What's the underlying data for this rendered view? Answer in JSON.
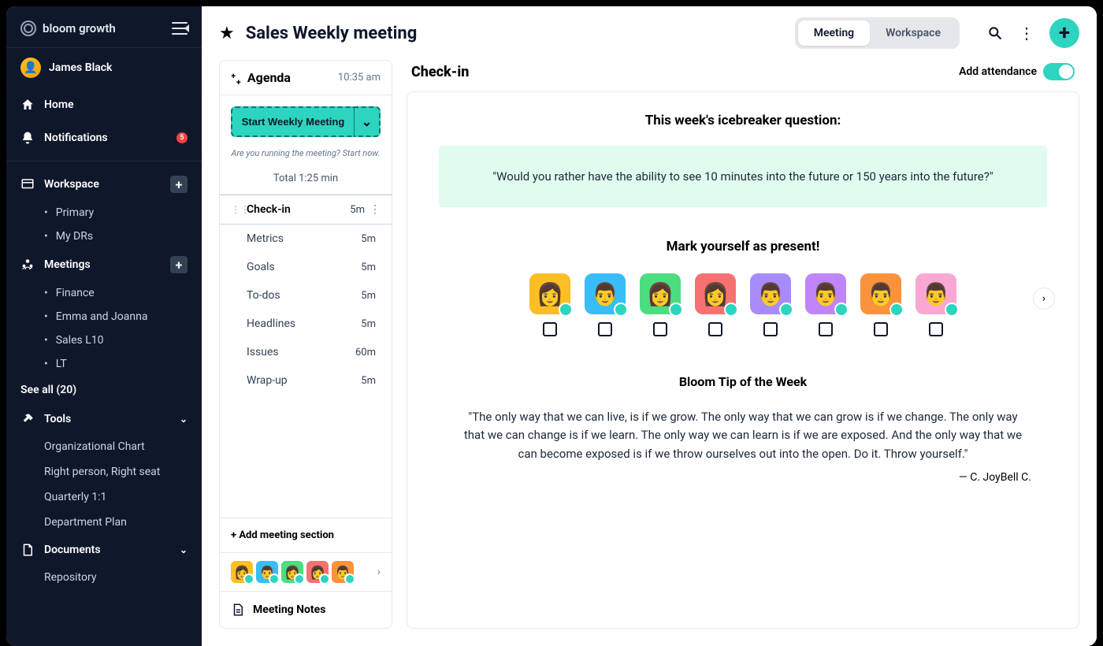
{
  "brand": {
    "name": "bloom growth"
  },
  "user": {
    "name": "James Black"
  },
  "nav": {
    "home": "Home",
    "notifications": "Notifications",
    "notif_count": "5"
  },
  "workspace": {
    "title": "Workspace",
    "items": [
      "Primary",
      "My DRs"
    ]
  },
  "meetings": {
    "title": "Meetings",
    "items": [
      "Finance",
      "Emma and Joanna",
      "Sales L10",
      "LT"
    ],
    "see_all": "See all (20)"
  },
  "tools": {
    "title": "Tools",
    "items": [
      "Organizational Chart",
      "Right person, Right seat",
      "Quarterly 1:1",
      "Department Plan"
    ]
  },
  "documents": {
    "title": "Documents",
    "items": [
      "Repository"
    ]
  },
  "page": {
    "title": "Sales Weekly meeting",
    "tabs": {
      "meeting": "Meeting",
      "workspace": "Workspace"
    }
  },
  "agenda": {
    "title": "Agenda",
    "time": "10:35 am",
    "start_label": "Start Weekly Meeting",
    "hint": "Are you running the meeting? Start now.",
    "total": "Total 1:25 min",
    "rows": [
      {
        "name": "Check-in",
        "dur": "5m"
      },
      {
        "name": "Metrics",
        "dur": "5m"
      },
      {
        "name": "Goals",
        "dur": "5m"
      },
      {
        "name": "To-dos",
        "dur": "5m"
      },
      {
        "name": "Headlines",
        "dur": "5m"
      },
      {
        "name": "Issues",
        "dur": "60m"
      },
      {
        "name": "Wrap-up",
        "dur": "5m"
      }
    ],
    "add_section": "+ Add meeting section",
    "meeting_notes": "Meeting Notes"
  },
  "checkin": {
    "title": "Check-in",
    "attendance_label": "Add attendance",
    "ice_title": "This week's icebreaker question:",
    "ice_question": "\"Would you rather have the ability to see 10 minutes into the future or 150 years into the future?\"",
    "mark_title": "Mark yourself as present!",
    "tip_title": "Bloom Tip of the Week",
    "tip_quote": "\"The only way that we can live, is if we grow. The only way that we can grow is if we change. The only way that we can change is if we learn. The only way we can learn is if we are exposed. And the only way that we can become exposed is if we throw ourselves out into the open. Do it. Throw yourself.\"",
    "tip_author": "— C. JoyBell C."
  },
  "colors": {
    "av": [
      "#fbbf24",
      "#38bdf8",
      "#4ade80",
      "#f87171",
      "#a78bfa",
      "#c084fc",
      "#fb923c",
      "#f9a8d4"
    ]
  }
}
